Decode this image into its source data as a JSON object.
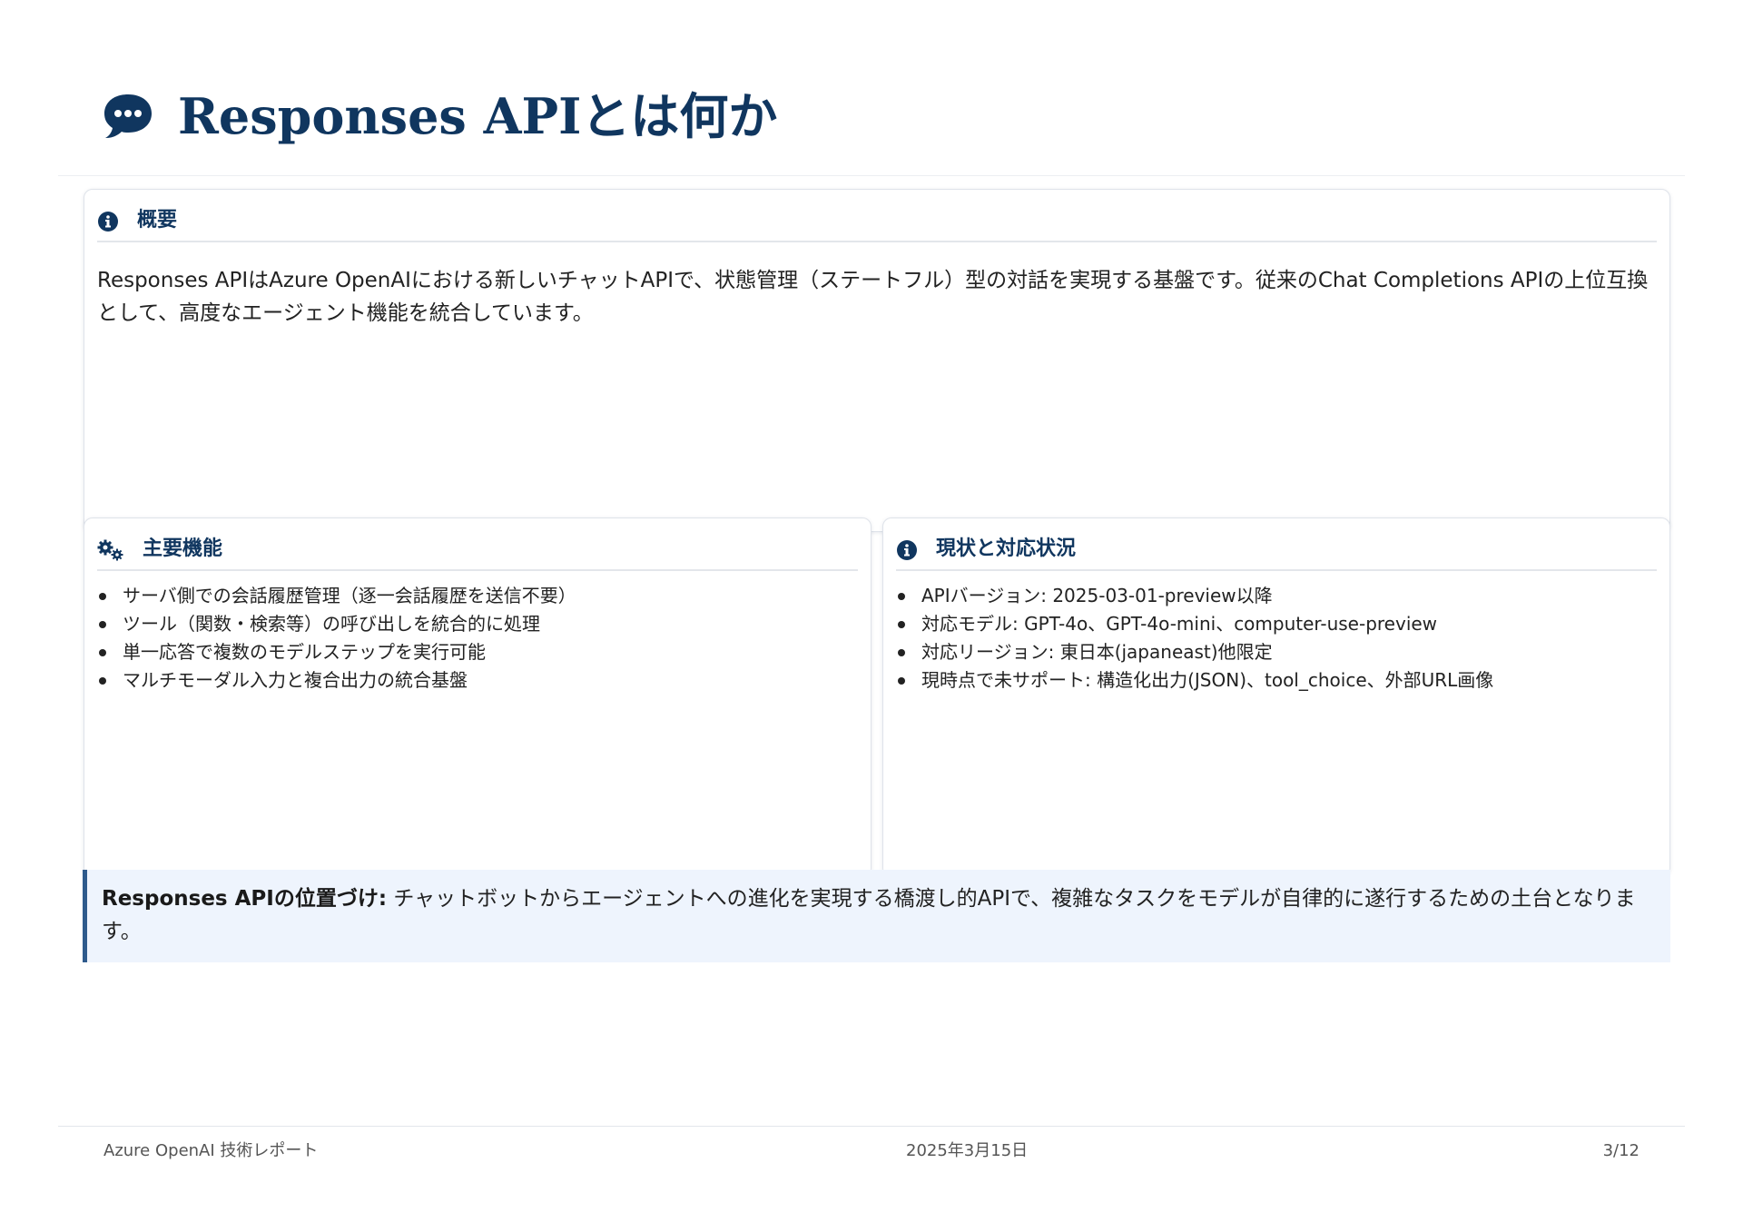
{
  "header": {
    "title": "Responses APIとは何か",
    "icon": "chat-bubble-icon"
  },
  "overview": {
    "heading": "概要",
    "icon": "info-circle-icon",
    "body": "Responses APIはAzure OpenAIにおける新しいチャットAPIで、状態管理（ステートフル）型の対話を実現する基盤です。従来のChat Completions APIの上位互換として、高度なエージェント機能を統合しています。"
  },
  "features": {
    "heading": "主要機能",
    "icon": "gears-icon",
    "items": [
      "サーバ側での会話履歴管理（逐一会話履歴を送信不要）",
      "ツール（関数・検索等）の呼び出しを統合的に処理",
      "単一応答で複数のモデルステップを実行可能",
      "マルチモーダル入力と複合出力の統合基盤"
    ]
  },
  "status": {
    "heading": "現状と対応状況",
    "icon": "info-circle-icon",
    "items": [
      "APIバージョン: 2025-03-01-preview以降",
      "対応モデル: GPT-4o、GPT-4o-mini、computer-use-preview",
      "対応リージョン: 東日本(japaneast)他限定",
      "現時点で未サポート: 構造化出力(JSON)、tool_choice、外部URL画像"
    ]
  },
  "callout": {
    "label": "Responses APIの位置づけ:",
    "text": " チャットボットからエージェントへの進化を実現する橋渡し的APIで、複雑なタスクをモデルが自律的に遂行するための土台となります。"
  },
  "footer": {
    "left": "Azure OpenAI 技術レポート",
    "center": "2025年3月15日",
    "right": "3/12"
  },
  "colors": {
    "heading": "#10365f",
    "callout_bg": "#eef4fd",
    "callout_border": "#2e5a8c"
  }
}
